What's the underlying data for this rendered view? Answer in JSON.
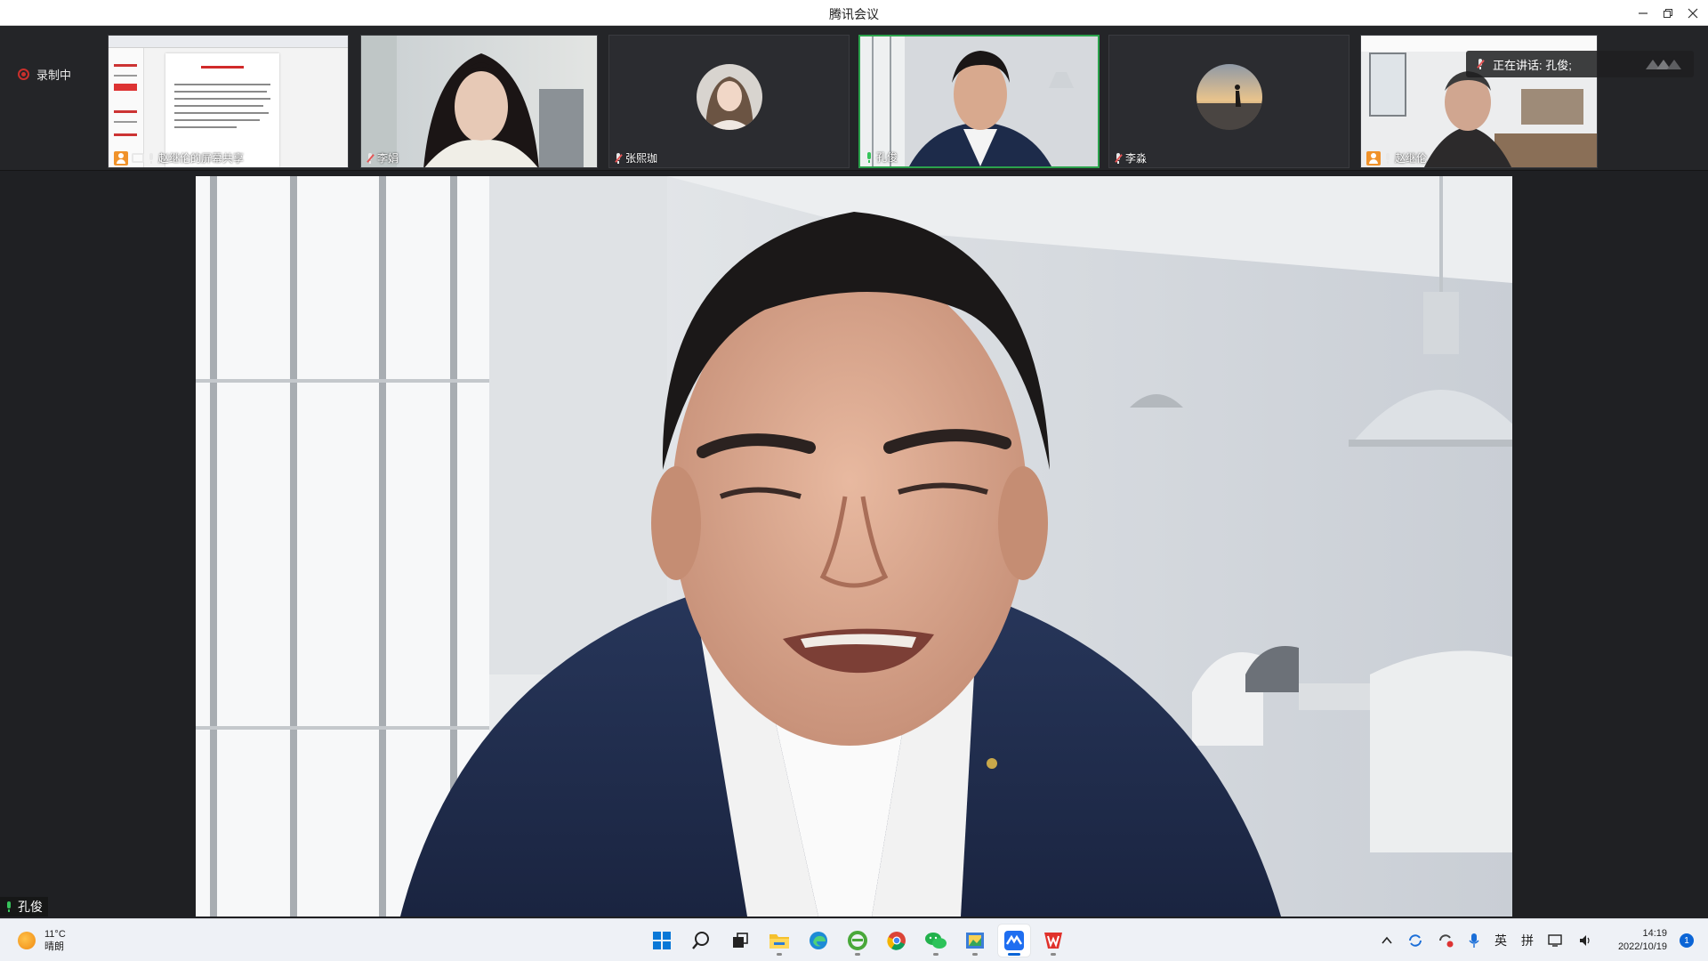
{
  "window": {
    "title": "腾讯会议"
  },
  "recording": {
    "label": "录制中"
  },
  "participants": [
    {
      "name": "赵继伦的屏幕共享",
      "kind": "screen-share"
    },
    {
      "name": "李娟",
      "kind": "video",
      "mic": "muted"
    },
    {
      "name": "张熙珈",
      "kind": "avatar",
      "mic": "muted"
    },
    {
      "name": "孔俊",
      "kind": "video",
      "mic": "active",
      "speaking": true
    },
    {
      "name": "李淼",
      "kind": "avatar",
      "mic": "muted"
    },
    {
      "name": "赵继伦",
      "kind": "video",
      "mic": "on",
      "host": true
    }
  ],
  "now_speaking": {
    "label": "正在讲话: 孔俊;"
  },
  "main_video": {
    "name": "孔俊"
  },
  "taskbar": {
    "weather_temp": "11°C",
    "weather_desc": "晴朗",
    "apps": [
      {
        "name": "windows-start",
        "color": "#0a78d7"
      },
      {
        "name": "search",
        "color": "#222222"
      },
      {
        "name": "task-view",
        "color": "#222222"
      },
      {
        "name": "file-explorer",
        "color": "#f5c12e"
      },
      {
        "name": "edge",
        "color": "#1d8bd6"
      },
      {
        "name": "ie-browser",
        "color": "#49a83a"
      },
      {
        "name": "chrome",
        "color": "#db4437"
      },
      {
        "name": "wechat",
        "color": "#22b14c"
      },
      {
        "name": "photo-app",
        "color": "#3b7dd8"
      },
      {
        "name": "tencent-meeting",
        "color": "#1f6ef0",
        "active": true
      },
      {
        "name": "wps-office",
        "color": "#e0312b"
      }
    ],
    "ime_lang": "英",
    "ime_mode": "拼",
    "time": "14:19",
    "date": "2022/10/19",
    "notification_count": "1"
  },
  "colors": {
    "accent_green": "#2ba24c",
    "record_red": "#c9302c",
    "host_orange": "#f0922a"
  }
}
